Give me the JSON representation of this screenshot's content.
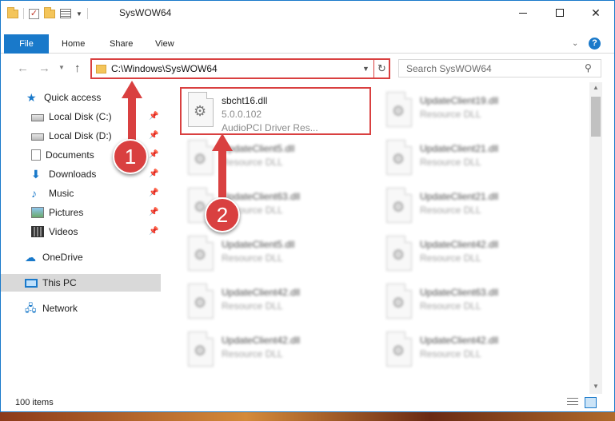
{
  "window": {
    "title": "SysWOW64",
    "close_glyph": "✕"
  },
  "ribbon": {
    "tabs": [
      "File",
      "Home",
      "Share",
      "View"
    ],
    "help": "?"
  },
  "address": {
    "path": "C:\\Windows\\SysWOW64",
    "search_placeholder": "Search SysWOW64"
  },
  "navpane": {
    "items": [
      {
        "label": "Quick access",
        "icon": "star-icon"
      },
      {
        "label": "Local Disk (C:)",
        "icon": "drive-icon",
        "pinned": true
      },
      {
        "label": "Local Disk (D:)",
        "icon": "drive-icon",
        "pinned": true
      },
      {
        "label": "Documents",
        "icon": "documents-icon",
        "pinned": true
      },
      {
        "label": "Downloads",
        "icon": "download-icon",
        "pinned": true
      },
      {
        "label": "Music",
        "icon": "music-icon",
        "pinned": true
      },
      {
        "label": "Pictures",
        "icon": "pictures-icon",
        "pinned": true
      },
      {
        "label": "Videos",
        "icon": "videos-icon",
        "pinned": true
      },
      {
        "label": "OneDrive",
        "icon": "cloud-icon"
      },
      {
        "label": "This PC",
        "icon": "computer-icon",
        "selected": true
      },
      {
        "label": "Network",
        "icon": "network-icon"
      }
    ]
  },
  "files": {
    "highlighted": {
      "name": "sbcht16.dll",
      "version": "5.0.0.102",
      "description": "AudioPCI Driver Res..."
    },
    "left_column": [
      {
        "name": "UpdateClient5.dll",
        "type": "Resource DLL"
      },
      {
        "name": "UpdateClient63.dll",
        "type": "Resource DLL"
      },
      {
        "name": "UpdateClient5.dll",
        "type": "Resource DLL"
      },
      {
        "name": "UpdateClient42.dll",
        "type": "Resource DLL"
      },
      {
        "name": "UpdateClient42.dll",
        "type": "Resource DLL"
      }
    ],
    "right_column": [
      {
        "name": "UpdateClient19.dll",
        "type": "Resource DLL"
      },
      {
        "name": "UpdateClient21.dll",
        "type": "Resource DLL"
      },
      {
        "name": "UpdateClient21.dll",
        "type": "Resource DLL"
      },
      {
        "name": "UpdateClient42.dll",
        "type": "Resource DLL"
      },
      {
        "name": "UpdateClient63.dll",
        "type": "Resource DLL"
      },
      {
        "name": "UpdateClient42.dll",
        "type": "Resource DLL"
      }
    ]
  },
  "status": {
    "count": "100 items"
  },
  "annotations": {
    "step1": "1",
    "step2": "2",
    "color": "#d94040"
  }
}
